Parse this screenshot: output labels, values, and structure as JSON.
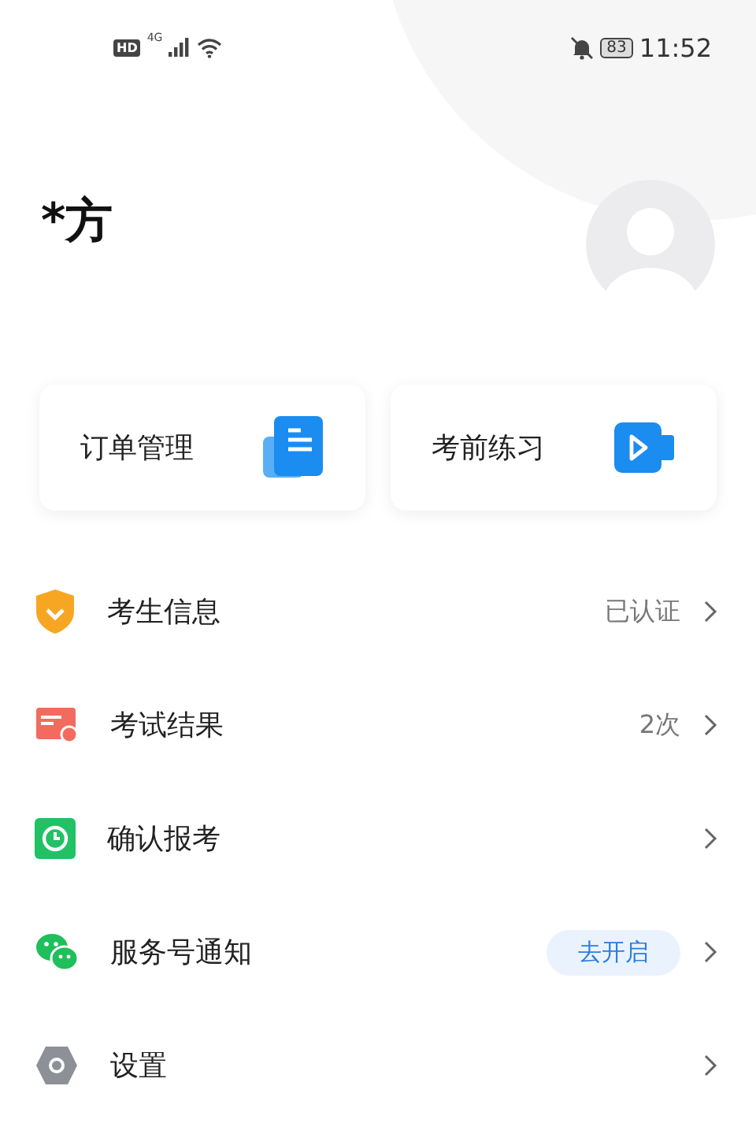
{
  "status_bar": {
    "network_badge": "HD",
    "network_type": "4G",
    "battery": "83",
    "time": "11:52"
  },
  "profile": {
    "name": "*方"
  },
  "shortcuts": [
    {
      "label": "订单管理",
      "kind": "document"
    },
    {
      "label": "考前练习",
      "kind": "video"
    }
  ],
  "menu": [
    {
      "label": "考生信息",
      "kind": "value",
      "value": "已认证"
    },
    {
      "label": "考试结果",
      "kind": "value",
      "value": "2次"
    },
    {
      "label": "确认报考",
      "kind": "plain"
    },
    {
      "label": "服务号通知",
      "kind": "action",
      "action": "去开启"
    },
    {
      "label": "设置",
      "kind": "plain"
    }
  ]
}
